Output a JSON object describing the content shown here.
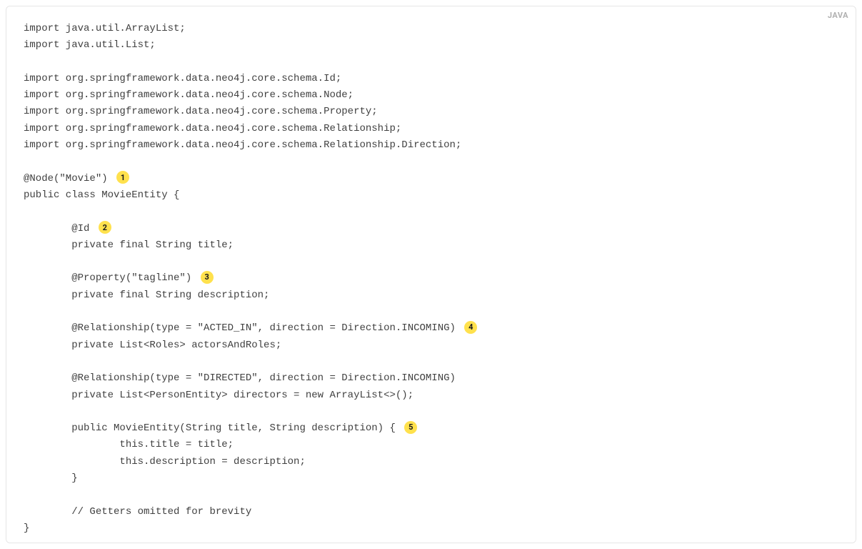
{
  "langLabel": "JAVA",
  "code": {
    "line1": "import java.util.ArrayList;",
    "line2": "import java.util.List;",
    "line3": "",
    "line4": "import org.springframework.data.neo4j.core.schema.Id;",
    "line5": "import org.springframework.data.neo4j.core.schema.Node;",
    "line6": "import org.springframework.data.neo4j.core.schema.Property;",
    "line7": "import org.springframework.data.neo4j.core.schema.Relationship;",
    "line8": "import org.springframework.data.neo4j.core.schema.Relationship.Direction;",
    "line9": "",
    "nodeAnno": "@Node(\"Movie\")",
    "classDecl": "public class MovieEntity {",
    "idAnno": "        @Id",
    "titleField": "        private final String title;",
    "propAnno": "        @Property(\"tagline\")",
    "descField": "        private final String description;",
    "relActed": "        @Relationship(type = \"ACTED_IN\", direction = Direction.INCOMING)",
    "actorsField": "        private List<Roles> actorsAndRoles;",
    "relDirected": "        @Relationship(type = \"DIRECTED\", direction = Direction.INCOMING)",
    "directorsField": "        private List<PersonEntity> directors = new ArrayList<>();",
    "ctorDecl": "        public MovieEntity(String title, String description) {",
    "ctorBody1": "                this.title = title;",
    "ctorBody2": "                this.description = description;",
    "ctorClose": "        }",
    "gettersComment": "        // Getters omitted for brevity",
    "classClose": "}"
  },
  "callouts": {
    "c1": "1",
    "c2": "2",
    "c3": "3",
    "c4": "4",
    "c5": "5"
  }
}
